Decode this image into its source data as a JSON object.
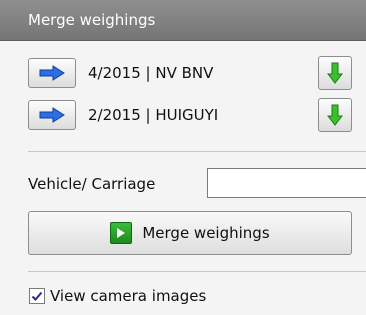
{
  "header": {
    "title": "Merge weighings"
  },
  "weighings": [
    {
      "label": "4/2015 | NV BNV",
      "arrow_icon": "arrow-right-icon",
      "down_icon": "arrow-down-icon"
    },
    {
      "label": "2/2015 | HUIGUYI",
      "arrow_icon": "arrow-right-icon",
      "down_icon": "arrow-down-icon"
    }
  ],
  "vehicle": {
    "label": "Vehicle/ Carriage",
    "value": ""
  },
  "merge_button": {
    "label": "Merge weighings",
    "icon": "play-icon"
  },
  "camera_option": {
    "label": "View camera images",
    "checked": true
  },
  "colors": {
    "header_bg": "#808080",
    "arrow_blue": "#2c6fe0",
    "accent_green": "#22a022"
  }
}
